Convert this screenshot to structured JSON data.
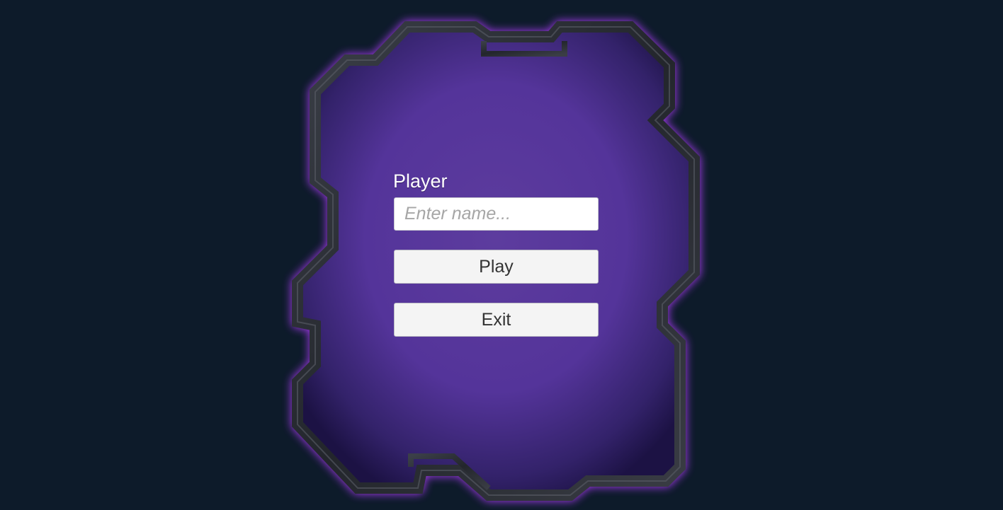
{
  "login": {
    "title": "Player",
    "name_placeholder": "Enter name...",
    "name_value": "",
    "play_label": "Play",
    "exit_label": "Exit"
  },
  "colors": {
    "background": "#0d1b2a",
    "panel_center": "#5b3a9c",
    "panel_edge": "#1e1448",
    "frame_metal": "#2c2f36",
    "frame_glow": "#b23cff",
    "button_face": "#f4f4f4",
    "button_text": "#333333",
    "label_text": "#ffffff"
  }
}
